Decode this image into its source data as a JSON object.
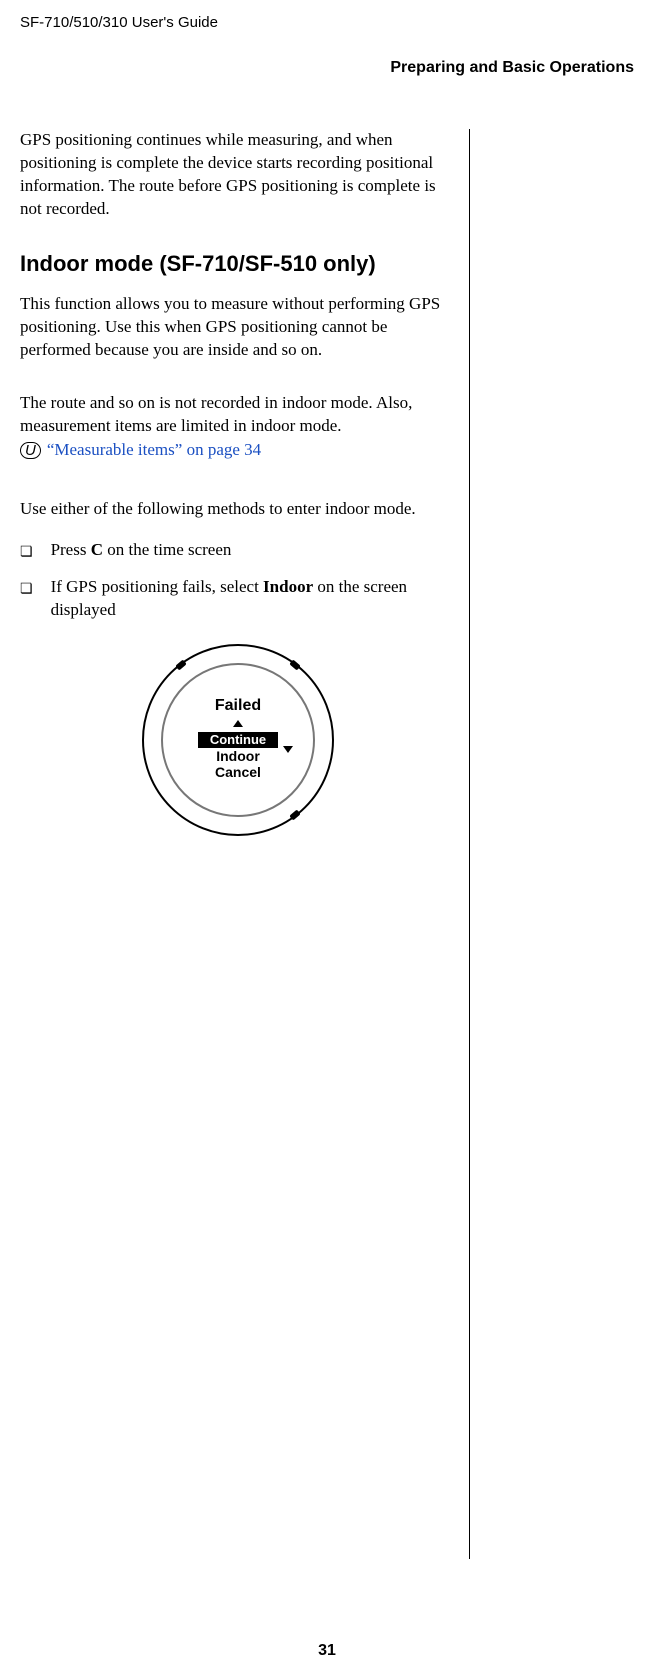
{
  "header": {
    "model_guide": "SF-710/510/310     User's Guide",
    "section": "Preparing and Basic Operations"
  },
  "body": {
    "intro_para": "GPS positioning continues while measuring, and when positioning is complete the device starts recording positional information. The route before GPS positioning is complete is not recorded.",
    "heading": "Indoor mode (SF-710/SF-510 only)",
    "para1": "This function allows you to measure without performing GPS positioning. Use this when GPS positioning cannot be performed because you are inside and so on.",
    "para2": "The route and so on is not recorded in indoor mode. Also, measurement items are limited in indoor mode.",
    "xref_text": "“Measurable items” on page 34",
    "para3": "Use either of the following methods to enter indoor mode.",
    "list": {
      "item1_pre": "Press ",
      "item1_bold": "C",
      "item1_post": " on the time screen",
      "item2_pre": "If GPS positioning fails, select ",
      "item2_bold": "Indoor",
      "item2_post": " on the screen displayed"
    },
    "device_screen": {
      "title": "Failed",
      "opt1": "Continue",
      "opt2": "Indoor",
      "opt3": "Cancel"
    }
  },
  "page_number": "31"
}
